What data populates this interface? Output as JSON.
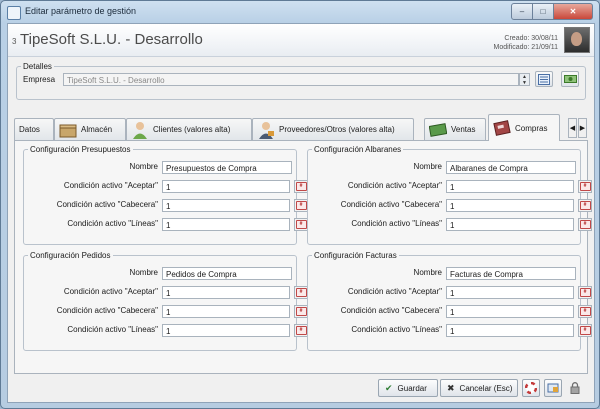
{
  "window": {
    "title": "Editar parámetro de gestión"
  },
  "header": {
    "record_number": "3",
    "app_title": "TipeSoft S.L.U. - Desarrollo",
    "created": "Creado: 30/08/11",
    "modified": "Modificado: 21/09/11"
  },
  "detalles": {
    "legend": "Detalles",
    "empresa_label": "Empresa",
    "empresa_value": "TipeSoft S.L.U. - Desarrollo"
  },
  "tabs": [
    {
      "label": "Datos"
    },
    {
      "label": "Almacén"
    },
    {
      "label": "Clientes (valores alta)"
    },
    {
      "label": "Proveedores/Otros (valores alta)"
    },
    {
      "label": "Ventas"
    },
    {
      "label": "Compras"
    }
  ],
  "sections": {
    "presupuestos": {
      "title": "Configuración Presupuestos",
      "nombre_label": "Nombre",
      "nombre_value": "Presupuestos de Compra",
      "aceptar_label": "Condición activo \"Aceptar\"",
      "aceptar_value": "1",
      "cabecera_label": "Condición activo \"Cabecera\"",
      "cabecera_value": "1",
      "lineas_label": "Condición activo \"Líneas\"",
      "lineas_value": "1"
    },
    "albaranes": {
      "title": "Configuración Albaranes",
      "nombre_label": "Nombre",
      "nombre_value": "Albaranes de Compra",
      "aceptar_label": "Condición activo \"Aceptar\"",
      "aceptar_value": "1",
      "cabecera_label": "Condición activo \"Cabecera\"",
      "cabecera_value": "1",
      "lineas_label": "Condición activo \"Líneas\"",
      "lineas_value": "1"
    },
    "pedidos": {
      "title": "Configuración Pedidos",
      "nombre_label": "Nombre",
      "nombre_value": "Pedidos de Compra",
      "aceptar_label": "Condición activo \"Aceptar\"",
      "aceptar_value": "1",
      "cabecera_label": "Condición activo \"Cabecera\"",
      "cabecera_value": "1",
      "lineas_label": "Condición activo \"Líneas\"",
      "lineas_value": "1"
    },
    "facturas": {
      "title": "Configuración Facturas",
      "nombre_label": "Nombre",
      "nombre_value": "Facturas de Compra",
      "aceptar_label": "Condición activo \"Aceptar\"",
      "aceptar_value": "1",
      "cabecera_label": "Condición activo \"Cabecera\"",
      "cabecera_value": "1",
      "lineas_label": "Condición activo \"Líneas\"",
      "lineas_value": "1"
    }
  },
  "footer": {
    "save_label": "Guardar",
    "cancel_label": "Cancelar (Esc)"
  },
  "colors": {
    "accent": "#b9d0e6",
    "error_red": "#c04848"
  }
}
